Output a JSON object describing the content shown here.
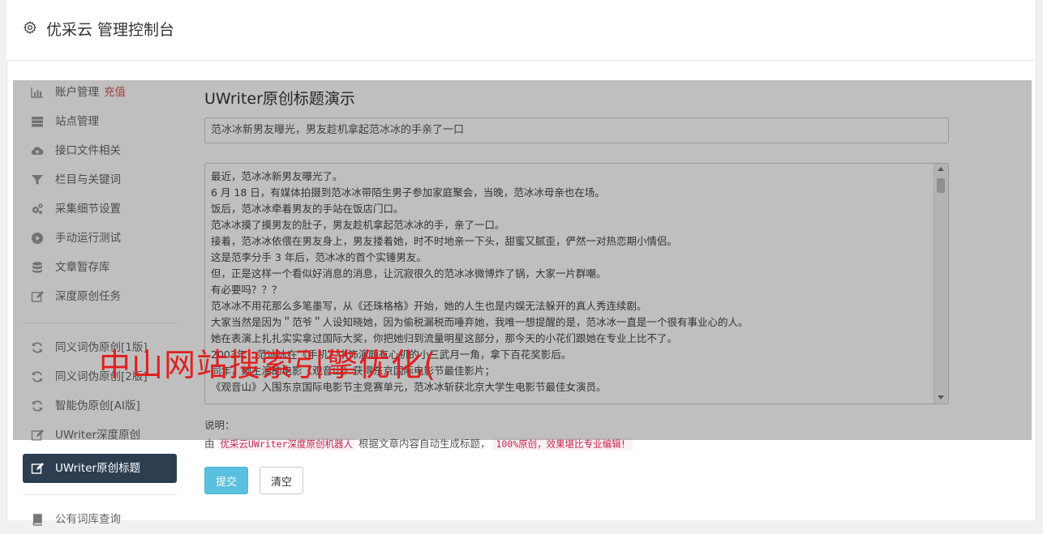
{
  "header": {
    "title": "优采云 管理控制台"
  },
  "sidebar": {
    "group1": [
      {
        "label": "账户管理",
        "tag": "充值",
        "icon": "bar-chart-icon"
      },
      {
        "label": "站点管理",
        "icon": "server-icon"
      },
      {
        "label": "接口文件相关",
        "icon": "cloud-upload-icon"
      },
      {
        "label": "栏目与关键词",
        "icon": "filter-icon"
      },
      {
        "label": "采集细节设置",
        "icon": "cogs-icon"
      },
      {
        "label": "手动运行测试",
        "icon": "play-circle-icon"
      },
      {
        "label": "文章暂存库",
        "icon": "database-icon"
      },
      {
        "label": "深度原创任务",
        "icon": "edit-icon"
      }
    ],
    "group2": [
      {
        "label": "同义词伪原创[1版]",
        "icon": "refresh-icon"
      },
      {
        "label": "同义词伪原创[2版]",
        "icon": "refresh-icon"
      },
      {
        "label": "智能伪原创[AI版]",
        "icon": "refresh-icon"
      },
      {
        "label": "UWriter深度原创",
        "icon": "edit-icon"
      },
      {
        "label": "UWriter原创标题",
        "icon": "edit-icon",
        "active": true
      }
    ],
    "group3": [
      {
        "label": "公有词库查询",
        "icon": "book-icon"
      }
    ]
  },
  "main": {
    "heading": "UWriter原创标题演示",
    "title_value": "范冰冰新男友曝光，男友趁机拿起范冰冰的手亲了一口",
    "content_lines": [
      "最近，范冰冰新男友曝光了。",
      "6 月 18 日，有媒体拍摄到范冰冰带陌生男子参加家庭聚会，当晚，范冰冰母亲也在场。",
      "饭后，范冰冰牵着男友的手站在饭店门口。",
      "范冰冰摸了摸男友的肚子，男友趁机拿起范冰冰的手，亲了一口。",
      "接着，范冰冰依偎在男友身上，男友搂着她，时不时地亲一下头，甜蜜又腻歪，俨然一对热恋期小情侣。",
      "这是范李分手 3 年后，范冰冰的首个实锤男友。",
      "但，正是这样一个看似好消息的消息，让沉寂很久的范冰冰微博炸了锅，大家一片群嘲。",
      "有必要吗？？？",
      "范冰冰不用花那么多笔墨写，从《还珠格格》开始，她的人生也是内娱无法躲开的真人秀连续剧。",
      "大家当然是因为＂范爷＂人设知晓她，因为偷税漏税而唾弃她，我唯一想提醒的是，范冰冰一直是一个很有事业心的人。",
      "她在表演上扎扎实实拿过国际大奖，你把她归到流量明星这部分，那今天的小花们跟她在专业上比不了。",
      "2003年，范冰冰在《手机》中饰演颇有心机的小三武月一角，拿下百花奖影后。",
      "同年，她主演的电影《观音山》获得东京国际电影节最佳影片；",
      "《观音山》入围东京国际电影节主竞赛单元，范冰冰斩获北京大学生电影节最佳女演员。"
    ],
    "notes_label": "说明：",
    "notes_prefix": "由",
    "notes_code1": "优采云UWriter深度原创机器人",
    "notes_middle": "根据文章内容自动生成标题，",
    "notes_code2": "100%原创，效果堪比专业编辑！",
    "submit_label": "提交",
    "clear_label": "清空"
  },
  "watermark": "中山网站搜索引擎优化(",
  "colors": {
    "active_nav_bg": "#2c3e50",
    "submit_btn": "#5bc0de",
    "recharge_tag": "#d9534f",
    "watermark": "#e02020"
  }
}
